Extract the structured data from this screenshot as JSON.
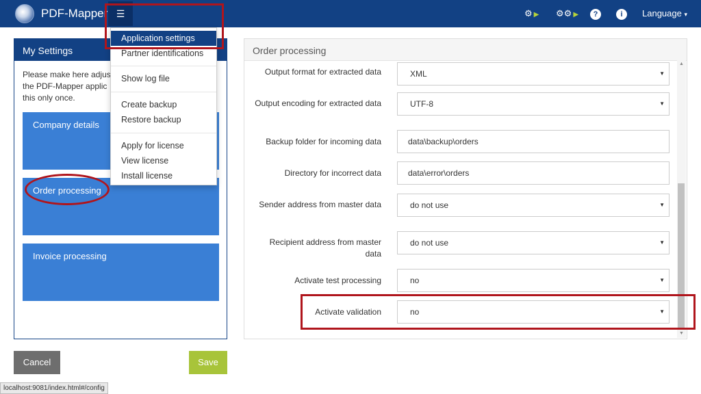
{
  "app": {
    "brand": "PDF-Mapper",
    "menu_icon": "hamburger-icon",
    "nav_icons": [
      "settings-play-icon",
      "multi-settings-play-icon",
      "help-icon",
      "info-icon"
    ],
    "language_label": "Language",
    "language_caret": "▾"
  },
  "dropdown": {
    "items": [
      "Application settings",
      "Partner identifications",
      "Show log file",
      "Create backup",
      "Restore backup",
      "Apply for license",
      "View license",
      "Install license"
    ]
  },
  "left_panel": {
    "title": "My Settings",
    "desc_line1": "Please make here adjus",
    "desc_line2": "the PDF-Mapper applic",
    "desc_line3": "this only once.",
    "tiles": [
      "Company details",
      "Order processing",
      "Invoice processing"
    ]
  },
  "buttons": {
    "cancel": "Cancel",
    "save": "Save"
  },
  "status_url": "localhost:9081/index.html#/config",
  "right_panel": {
    "title": "Order processing",
    "rows": [
      {
        "label": "Output format for extracted data",
        "value": "XML",
        "type": "select"
      },
      {
        "label": "Output encoding for extracted data",
        "value": "UTF-8",
        "type": "select"
      },
      {
        "label": "Backup folder for incoming data",
        "value": "data\\backup\\orders",
        "type": "input"
      },
      {
        "label": "Directory for incorrect data",
        "value": "data\\error\\orders",
        "type": "input"
      },
      {
        "label": "Sender address from master data",
        "value": "do not use",
        "type": "select"
      },
      {
        "label": "Recipient address from master data",
        "value": "do not use",
        "type": "select"
      },
      {
        "label": "Activate test processing",
        "value": "no",
        "type": "select"
      },
      {
        "label": "Activate validation",
        "value": "no",
        "type": "select"
      }
    ]
  },
  "colors": {
    "navbar": "#124184",
    "tile": "#3a7fd5",
    "save": "#a8c43a",
    "cancel": "#6e6e6e",
    "annotation": "#b0151c"
  }
}
